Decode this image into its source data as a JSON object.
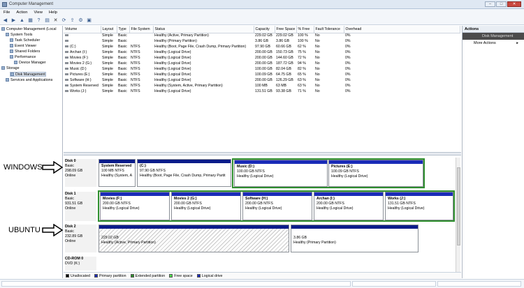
{
  "window": {
    "title": "Computer Management",
    "min": "–",
    "max": "□",
    "close": "✕"
  },
  "menu": [
    "File",
    "Action",
    "View",
    "Help"
  ],
  "toolbar_icons": [
    "back-icon",
    "forward-icon",
    "up-icon",
    "properties-icon",
    "help-icon",
    "show-hide-icon",
    "delete-icon",
    "refresh-icon",
    "export-icon",
    "settings-icon",
    "view-icon"
  ],
  "tree": {
    "root": "Computer Management (Local",
    "system_tools": "System Tools",
    "task_scheduler": "Task Scheduler",
    "event_viewer": "Event Viewer",
    "shared_folders": "Shared Folders",
    "performance": "Performance",
    "device_manager": "Device Manager",
    "storage": "Storage",
    "disk_management": "Disk Management",
    "services": "Services and Applications"
  },
  "volume_table": {
    "headers": [
      "Volume",
      "Layout",
      "Type",
      "File System",
      "Status",
      "Capacity",
      "Free Space",
      "% Free",
      "Fault Tolerance",
      "Overhead"
    ],
    "rows": [
      [
        "",
        "Simple",
        "Basic",
        "",
        "Healthy (Active, Primary Partition)",
        "229.02 GB",
        "229.02 GB",
        "100 %",
        "No",
        "0%"
      ],
      [
        "",
        "Simple",
        "Basic",
        "",
        "Healthy (Primary Partition)",
        "3.86 GB",
        "3.86 GB",
        "100 %",
        "No",
        "0%"
      ],
      [
        "(C:)",
        "Simple",
        "Basic",
        "NTFS",
        "Healthy (Boot, Page File, Crash Dump, Primary Partition)",
        "97.90 GB",
        "60.66 GB",
        "62 %",
        "No",
        "0%"
      ],
      [
        "Archan (I:)",
        "Simple",
        "Basic",
        "NTFS",
        "Healthy (Logical Drive)",
        "200.00 GB",
        "150.73 GB",
        "75 %",
        "No",
        "0%"
      ],
      [
        "Movies (F:)",
        "Simple",
        "Basic",
        "NTFS",
        "Healthy (Logical Drive)",
        "200.00 GB",
        "144.60 GB",
        "72 %",
        "No",
        "0%"
      ],
      [
        "Movies 2 (G:)",
        "Simple",
        "Basic",
        "NTFS",
        "Healthy (Logical Drive)",
        "200.00 GB",
        "187.72 GB",
        "94 %",
        "No",
        "0%"
      ],
      [
        "Music (D:)",
        "Simple",
        "Basic",
        "NTFS",
        "Healthy (Logical Drive)",
        "100.00 GB",
        "82.04 GB",
        "82 %",
        "No",
        "0%"
      ],
      [
        "Pictures (E:)",
        "Simple",
        "Basic",
        "NTFS",
        "Healthy (Logical Drive)",
        "100.09 GB",
        "64.75 GB",
        "65 %",
        "No",
        "0%"
      ],
      [
        "Software (H:)",
        "Simple",
        "Basic",
        "NTFS",
        "Healthy (Logical Drive)",
        "200.00 GB",
        "126.29 GB",
        "63 %",
        "No",
        "0%"
      ],
      [
        "System Reserved",
        "Simple",
        "Basic",
        "NTFS",
        "Healthy (System, Active, Primary Partition)",
        "100 MB",
        "63 MB",
        "63 %",
        "No",
        "0%"
      ],
      [
        "Works (J:)",
        "Simple",
        "Basic",
        "NTFS",
        "Healthy (Logical Drive)",
        "131.51 GB",
        "93.38 GB",
        "71 %",
        "No",
        "0%"
      ]
    ]
  },
  "disks": [
    {
      "name": "Disk 0",
      "type": "Basic",
      "size": "298.09 GB",
      "state": "Online"
    },
    {
      "name": "Disk 1",
      "type": "Basic",
      "size": "931.51 GB",
      "state": "Online"
    },
    {
      "name": "Disk 2",
      "type": "Basic",
      "size": "232.89 GB",
      "state": "Online"
    },
    {
      "name": "CD-ROM 0",
      "type": "DVD (K:)"
    }
  ],
  "partitions": {
    "d0": [
      {
        "name": "System Reserved",
        "size": "100 MB NTFS",
        "status": "Healthy (System, A"
      },
      {
        "name": "(C:)",
        "size": "97.90 GB NTFS",
        "status": "Healthy (Boot, Page File, Crash Dump, Primary Partit"
      },
      {
        "name": "Music  (D:)",
        "size": "100.00 GB NTFS",
        "status": "Healthy (Logical Drive)"
      },
      {
        "name": "Pictures  (E:)",
        "size": "100.09 GB NTFS",
        "status": "Healthy (Logical Drive)"
      }
    ],
    "d1": [
      {
        "name": "Movies  (F:)",
        "size": "200.00 GB NTFS",
        "status": "Healthy (Logical Drive)"
      },
      {
        "name": "Movies 2  (G:)",
        "size": "200.00 GB NTFS",
        "status": "Healthy (Logical Drive)"
      },
      {
        "name": "Software  (H:)",
        "size": "200.00 GB NTFS",
        "status": "Healthy (Logical Drive)"
      },
      {
        "name": "Archan  (I:)",
        "size": "200.00 GB NTFS",
        "status": "Healthy (Logical Drive)"
      },
      {
        "name": "Works  (J:)",
        "size": "131.51 GB NTFS",
        "status": "Healthy (Logical Drive)"
      }
    ],
    "d2": [
      {
        "size": "229.02 GB",
        "status": "Healthy (Active, Primary Partition)"
      },
      {
        "size": "3.86 GB",
        "status": "Healthy (Primary Partition)"
      }
    ]
  },
  "legend": [
    {
      "label": "Unallocated",
      "color": "#000000"
    },
    {
      "label": "Primary partition",
      "color": "#1a2bb8"
    },
    {
      "label": "Extended partition",
      "color": "#2f8f2f"
    },
    {
      "label": "Free space",
      "color": "#4fe04f"
    },
    {
      "label": "Logical drive",
      "color": "#1a2bb8"
    }
  ],
  "actions": {
    "header": "Actions",
    "selected": "Disk Management",
    "more": "More Actions",
    "chevron": "▸"
  },
  "annotations": {
    "windows": "WINDOWS",
    "ubuntu": "UBUNTU"
  }
}
